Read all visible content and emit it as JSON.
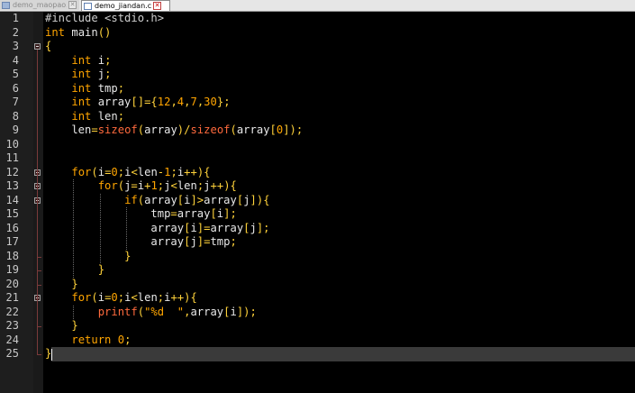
{
  "tabs": [
    {
      "label": "demo_maopao.c",
      "active": false
    },
    {
      "label": "demo_jiandan.c",
      "active": true
    }
  ],
  "editor": {
    "current_line": 25,
    "lines": [
      [
        [
          "pp",
          "#include <stdio.h>"
        ]
      ],
      [
        [
          "ty",
          "int"
        ],
        [
          "plain",
          " main"
        ],
        [
          "op",
          "()"
        ]
      ],
      [
        [
          "op",
          "{"
        ]
      ],
      [
        [
          "plain",
          "    "
        ],
        [
          "ty",
          "int"
        ],
        [
          "plain",
          " i"
        ],
        [
          "op",
          ";"
        ]
      ],
      [
        [
          "plain",
          "    "
        ],
        [
          "ty",
          "int"
        ],
        [
          "plain",
          " j"
        ],
        [
          "op",
          ";"
        ]
      ],
      [
        [
          "plain",
          "    "
        ],
        [
          "ty",
          "int"
        ],
        [
          "plain",
          " tmp"
        ],
        [
          "op",
          ";"
        ]
      ],
      [
        [
          "plain",
          "    "
        ],
        [
          "ty",
          "int"
        ],
        [
          "plain",
          " array"
        ],
        [
          "op",
          "[]={"
        ],
        [
          "num",
          "12"
        ],
        [
          "op",
          ","
        ],
        [
          "num",
          "4"
        ],
        [
          "op",
          ","
        ],
        [
          "num",
          "7"
        ],
        [
          "op",
          ","
        ],
        [
          "num",
          "30"
        ],
        [
          "op",
          "};"
        ]
      ],
      [
        [
          "plain",
          "    "
        ],
        [
          "ty",
          "int"
        ],
        [
          "plain",
          " len"
        ],
        [
          "op",
          ";"
        ]
      ],
      [
        [
          "plain",
          "    len"
        ],
        [
          "op",
          "="
        ],
        [
          "fn",
          "sizeof"
        ],
        [
          "op",
          "("
        ],
        [
          "plain",
          "array"
        ],
        [
          "op",
          ")/"
        ],
        [
          "fn",
          "sizeof"
        ],
        [
          "op",
          "("
        ],
        [
          "plain",
          "array"
        ],
        [
          "op",
          "["
        ],
        [
          "num",
          "0"
        ],
        [
          "op",
          "]);"
        ]
      ],
      [
        [
          "plain",
          ""
        ]
      ],
      [
        [
          "plain",
          ""
        ]
      ],
      [
        [
          "plain",
          "    "
        ],
        [
          "kw",
          "for"
        ],
        [
          "op",
          "("
        ],
        [
          "plain",
          "i"
        ],
        [
          "op",
          "="
        ],
        [
          "num",
          "0"
        ],
        [
          "op",
          ";"
        ],
        [
          "plain",
          "i"
        ],
        [
          "op",
          "<"
        ],
        [
          "plain",
          "len"
        ],
        [
          "op",
          "-"
        ],
        [
          "num",
          "1"
        ],
        [
          "op",
          ";"
        ],
        [
          "plain",
          "i"
        ],
        [
          "op",
          "++){"
        ]
      ],
      [
        [
          "plain",
          "        "
        ],
        [
          "kw",
          "for"
        ],
        [
          "op",
          "("
        ],
        [
          "plain",
          "j"
        ],
        [
          "op",
          "="
        ],
        [
          "plain",
          "i"
        ],
        [
          "op",
          "+"
        ],
        [
          "num",
          "1"
        ],
        [
          "op",
          ";"
        ],
        [
          "plain",
          "j"
        ],
        [
          "op",
          "<"
        ],
        [
          "plain",
          "len"
        ],
        [
          "op",
          ";"
        ],
        [
          "plain",
          "j"
        ],
        [
          "op",
          "++){"
        ]
      ],
      [
        [
          "plain",
          "            "
        ],
        [
          "kw",
          "if"
        ],
        [
          "op",
          "("
        ],
        [
          "plain",
          "array"
        ],
        [
          "op",
          "["
        ],
        [
          "plain",
          "i"
        ],
        [
          "op",
          "]>"
        ],
        [
          "plain",
          "array"
        ],
        [
          "op",
          "["
        ],
        [
          "plain",
          "j"
        ],
        [
          "op",
          "]){"
        ]
      ],
      [
        [
          "plain",
          "                tmp"
        ],
        [
          "op",
          "="
        ],
        [
          "plain",
          "array"
        ],
        [
          "op",
          "["
        ],
        [
          "plain",
          "i"
        ],
        [
          "op",
          "];"
        ]
      ],
      [
        [
          "plain",
          "                array"
        ],
        [
          "op",
          "["
        ],
        [
          "plain",
          "i"
        ],
        [
          "op",
          "]="
        ],
        [
          "plain",
          "array"
        ],
        [
          "op",
          "["
        ],
        [
          "plain",
          "j"
        ],
        [
          "op",
          "];"
        ]
      ],
      [
        [
          "plain",
          "                array"
        ],
        [
          "op",
          "["
        ],
        [
          "plain",
          "j"
        ],
        [
          "op",
          "]="
        ],
        [
          "plain",
          "tmp"
        ],
        [
          "op",
          ";"
        ]
      ],
      [
        [
          "plain",
          "            "
        ],
        [
          "op",
          "}"
        ]
      ],
      [
        [
          "plain",
          "        "
        ],
        [
          "op",
          "}"
        ]
      ],
      [
        [
          "plain",
          "    "
        ],
        [
          "op",
          "}"
        ]
      ],
      [
        [
          "plain",
          "    "
        ],
        [
          "kw",
          "for"
        ],
        [
          "op",
          "("
        ],
        [
          "plain",
          "i"
        ],
        [
          "op",
          "="
        ],
        [
          "num",
          "0"
        ],
        [
          "op",
          ";"
        ],
        [
          "plain",
          "i"
        ],
        [
          "op",
          "<"
        ],
        [
          "plain",
          "len"
        ],
        [
          "op",
          ";"
        ],
        [
          "plain",
          "i"
        ],
        [
          "op",
          "++){"
        ]
      ],
      [
        [
          "plain",
          "        "
        ],
        [
          "fn",
          "printf"
        ],
        [
          "op",
          "("
        ],
        [
          "str",
          "\"%d  \""
        ],
        [
          "op",
          ","
        ],
        [
          "plain",
          "array"
        ],
        [
          "op",
          "["
        ],
        [
          "plain",
          "i"
        ],
        [
          "op",
          "]);"
        ]
      ],
      [
        [
          "plain",
          "    "
        ],
        [
          "op",
          "}"
        ]
      ],
      [
        [
          "plain",
          "    "
        ],
        [
          "kw",
          "return"
        ],
        [
          "plain",
          " "
        ],
        [
          "num",
          "0"
        ],
        [
          "op",
          ";"
        ]
      ],
      [
        [
          "op",
          "}"
        ]
      ]
    ]
  },
  "colors": {
    "background": "#000000",
    "gutter": "#1e1e1e",
    "keyword": "#ffa500",
    "function": "#ff6a3d",
    "operator": "#ffd23a",
    "text": "#e8e8e8",
    "current_line": "#3a3a3a"
  },
  "icons": {
    "tab_file": "file-icon",
    "tab_close": "close-icon",
    "fold": "fold-collapse-icon"
  }
}
